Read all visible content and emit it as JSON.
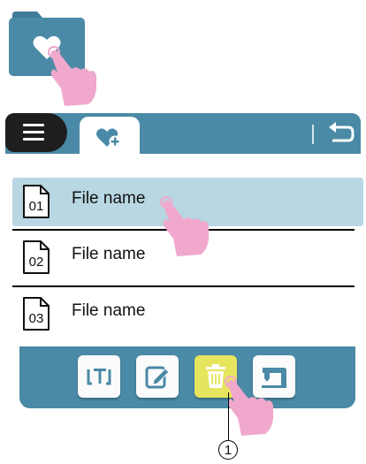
{
  "header": {
    "menu_icon": "menu-icon",
    "active_tab_icon": "heart-plus-icon",
    "back_icon": "back-arrow-icon"
  },
  "folder": {
    "icon": "heart-folder-icon"
  },
  "files": [
    {
      "number": "01",
      "name": "File name",
      "selected": true
    },
    {
      "number": "02",
      "name": "File name",
      "selected": false
    },
    {
      "number": "03",
      "name": "File name",
      "selected": false
    }
  ],
  "toolbar": {
    "buttons": [
      {
        "icon": "rename-text-icon",
        "active": false
      },
      {
        "icon": "edit-pencil-icon",
        "active": false
      },
      {
        "icon": "trash-icon",
        "active": true
      },
      {
        "icon": "sewing-machine-icon",
        "active": false
      }
    ]
  },
  "callout": {
    "label": "1"
  },
  "colors": {
    "panel": "#4a8aa6",
    "selected_row": "#b8d7e3",
    "active_button": "#e7e55e",
    "hand": "#f0a8cc"
  }
}
